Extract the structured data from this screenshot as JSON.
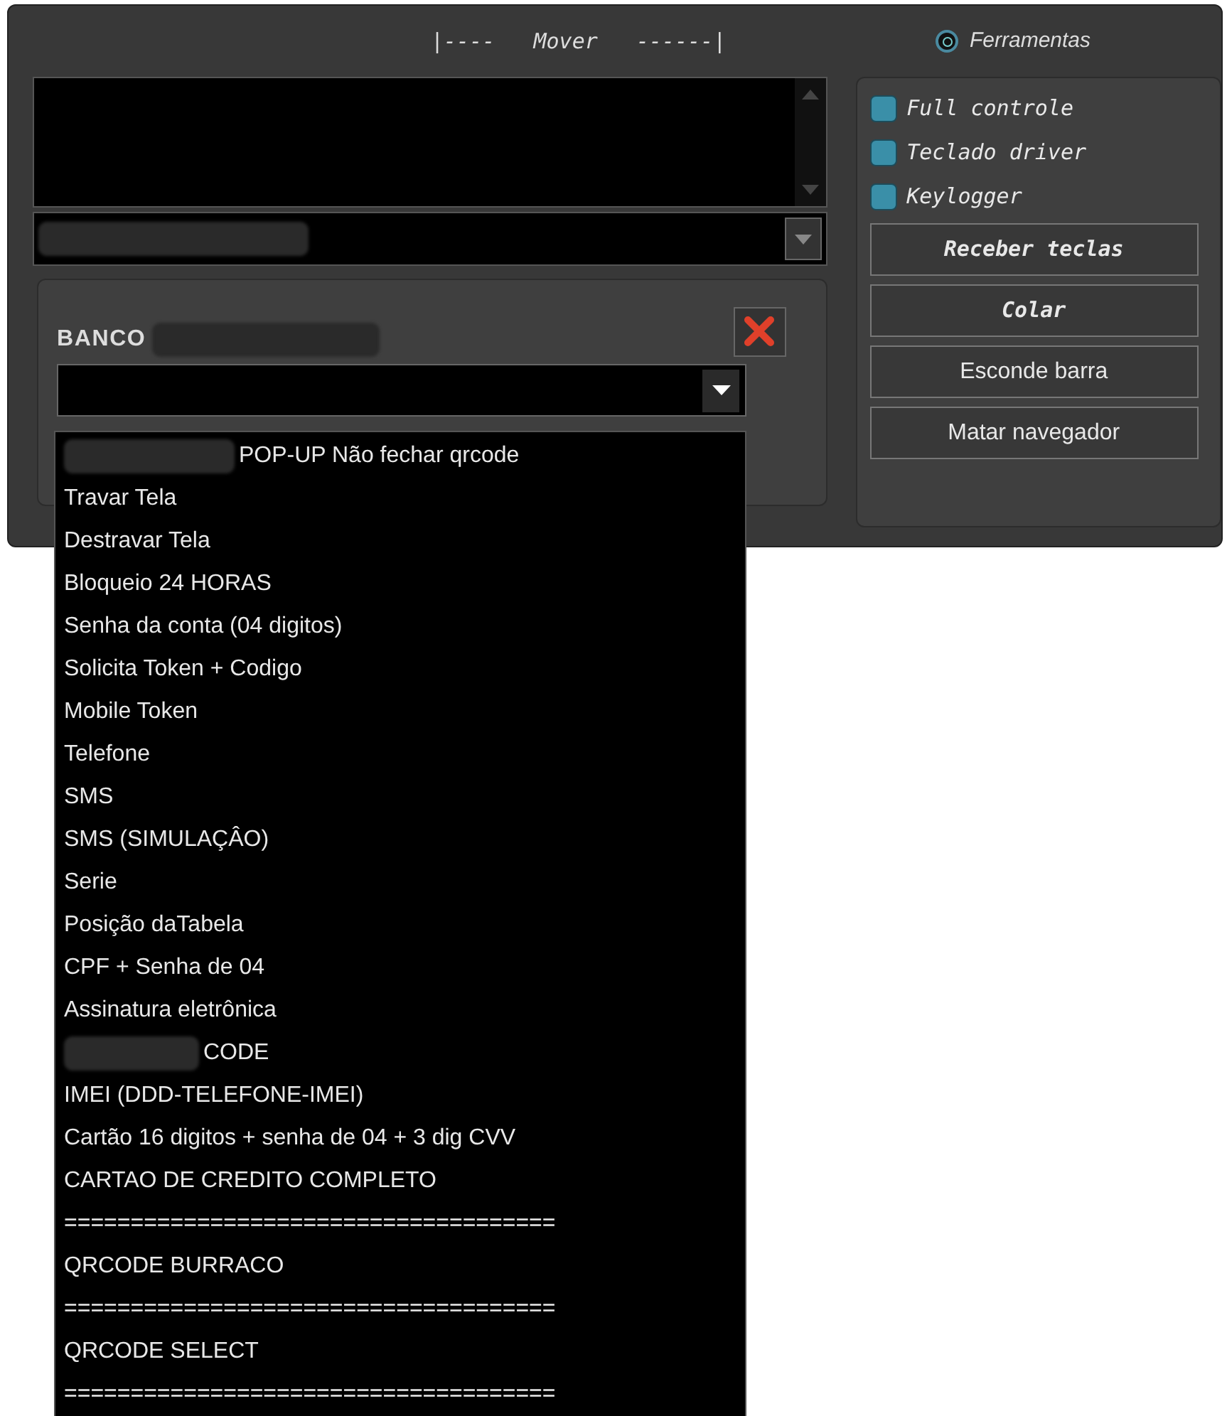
{
  "header": {
    "move_label": "|----   Mover   ------|",
    "radio": {
      "label": "Ferramentas",
      "selected": true
    }
  },
  "client_combo": {
    "redacted": true
  },
  "bank_panel": {
    "label": "BANCO",
    "redacted": true,
    "select": {
      "expanded": true
    },
    "options": [
      {
        "text": "POP-UP Não fechar qrcode",
        "redacted_prefix": true
      },
      {
        "text": "Travar Tela",
        "redacted_prefix": false
      },
      {
        "text": "Destravar Tela",
        "redacted_prefix": false
      },
      {
        "text": "Bloqueio 24 HORAS",
        "redacted_prefix": false
      },
      {
        "text": "Senha da conta (04 digitos)",
        "redacted_prefix": false
      },
      {
        "text": "Solicita Token + Codigo",
        "redacted_prefix": false
      },
      {
        "text": "Mobile Token",
        "redacted_prefix": false
      },
      {
        "text": "Telefone",
        "redacted_prefix": false
      },
      {
        "text": "SMS",
        "redacted_prefix": false
      },
      {
        "text": "SMS (SIMULAÇÂO)",
        "redacted_prefix": false
      },
      {
        "text": "Serie",
        "redacted_prefix": false
      },
      {
        "text": "Posição daTabela",
        "redacted_prefix": false
      },
      {
        "text": "CPF + Senha de 04",
        "redacted_prefix": false
      },
      {
        "text": "Assinatura eletrônica",
        "redacted_prefix": false
      },
      {
        "text": "CODE",
        "redacted_prefix": true
      },
      {
        "text": "IMEI (DDD-TELEFONE-IMEI)",
        "redacted_prefix": false
      },
      {
        "text": "Cartão 16 digitos + senha de 04 + 3 dig CVV",
        "redacted_prefix": false
      },
      {
        "text": "CARTAO DE CREDITO COMPLETO",
        "redacted_prefix": false
      },
      {
        "text": "=====================================",
        "redacted_prefix": false
      },
      {
        "text": "QRCODE BURRACO",
        "redacted_prefix": false
      },
      {
        "text": "=====================================",
        "redacted_prefix": false
      },
      {
        "text": "QRCODE SELECT",
        "redacted_prefix": false
      },
      {
        "text": "=====================================",
        "redacted_prefix": false
      }
    ]
  },
  "tools": {
    "checkboxes": [
      {
        "label": "Full controle",
        "checked": false
      },
      {
        "label": "Teclado driver",
        "checked": false
      },
      {
        "label": "Keylogger",
        "checked": false
      }
    ],
    "buttons": [
      {
        "label": "Receber teclas",
        "kind": "italic"
      },
      {
        "label": "Colar",
        "kind": "italic"
      },
      {
        "label": "Esconde barra",
        "kind": "plain"
      },
      {
        "label": "Matar navegador",
        "kind": "plain"
      }
    ]
  }
}
